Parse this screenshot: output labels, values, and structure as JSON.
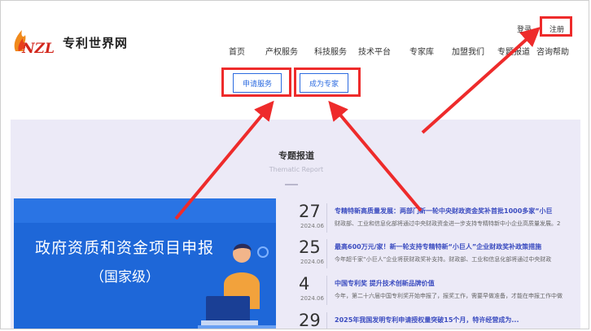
{
  "logo": {
    "mark_text": "NZL",
    "name": "专利世界网"
  },
  "header": {
    "login": "登录",
    "register": "注册"
  },
  "nav": [
    "首页",
    "产权服务",
    "科技服务",
    "技术平台",
    "专家库",
    "加盟我们",
    "专题报道",
    "咨询帮助"
  ],
  "buttons": {
    "apply": "申请服务",
    "expert": "成为专家"
  },
  "section": {
    "title": "专题报道",
    "subtitle": "Thematic Report"
  },
  "banner": {
    "title": "政府资质和资金项目申报",
    "subtitle": "（国家级）"
  },
  "news": [
    {
      "day": "27",
      "ym": "2024.06",
      "title": "专精特新高质量发展：两部门新一轮中央财政资金奖补首批1000多家“小巨",
      "desc": "财政部、工业和信息化部将通过中央财政资金进一步支持专精特新中小企业高质量发展。2"
    },
    {
      "day": "25",
      "ym": "2024.06",
      "title": "最高600万元/家！新一轮支持专精特新“小巨人”企业财政奖补政策措施",
      "desc": "今年超千家“小巨人”企业将获财政奖补支持。财政部、工业和信息化部将通过中央财政"
    },
    {
      "day": "4",
      "ym": "2024.06",
      "title": "中国专利奖 提升技术创新品牌价值",
      "desc": "今年，第二十六届中国专利奖开始申报了，报奖工作，需要早做准备，才能在申报工作中做"
    },
    {
      "day": "29",
      "ym": "",
      "title": "2025年我国发明专利申请授权量突破15个月，特许经营成为...",
      "desc": ""
    }
  ],
  "colors": {
    "accent": "#2c6be0",
    "highlight": "#ee2b2b",
    "banner": "#1e67d8",
    "section_bg": "#eceaf7"
  }
}
